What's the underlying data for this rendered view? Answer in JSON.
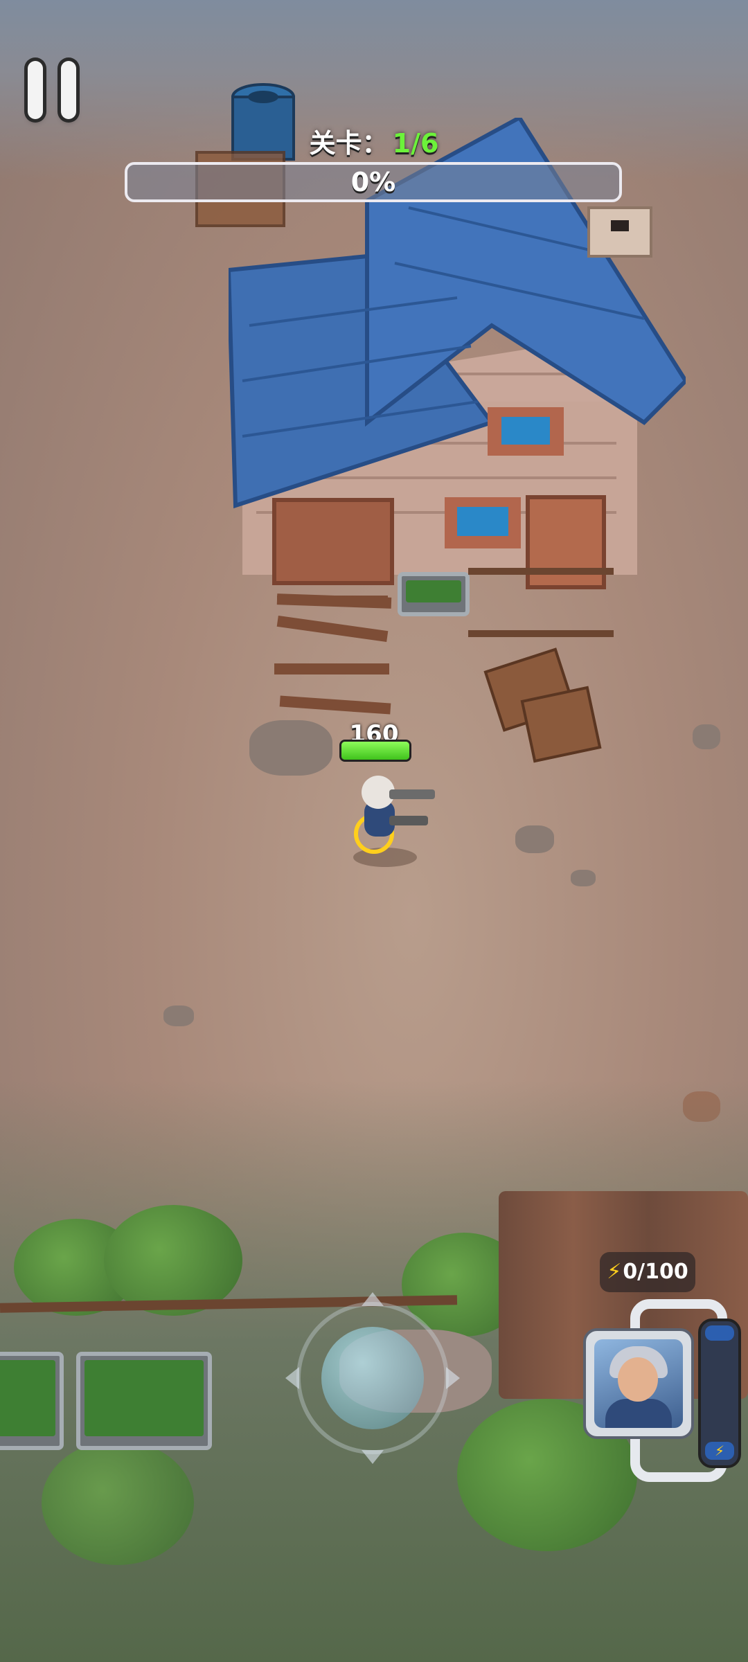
{
  "hud": {
    "level_label": "关卡：",
    "level_value": "1/6",
    "progress_text": "0%",
    "progress_fraction": 0,
    "pause_icon": "pause-icon"
  },
  "player": {
    "health_value": "160",
    "health_fraction": 1.0
  },
  "skill": {
    "energy_text": "0/100",
    "energy_icon": "lightning-icon",
    "energy_fraction": 0
  },
  "colors": {
    "accent_green": "#6cf23a",
    "energy_yellow": "#ffcf1d"
  }
}
